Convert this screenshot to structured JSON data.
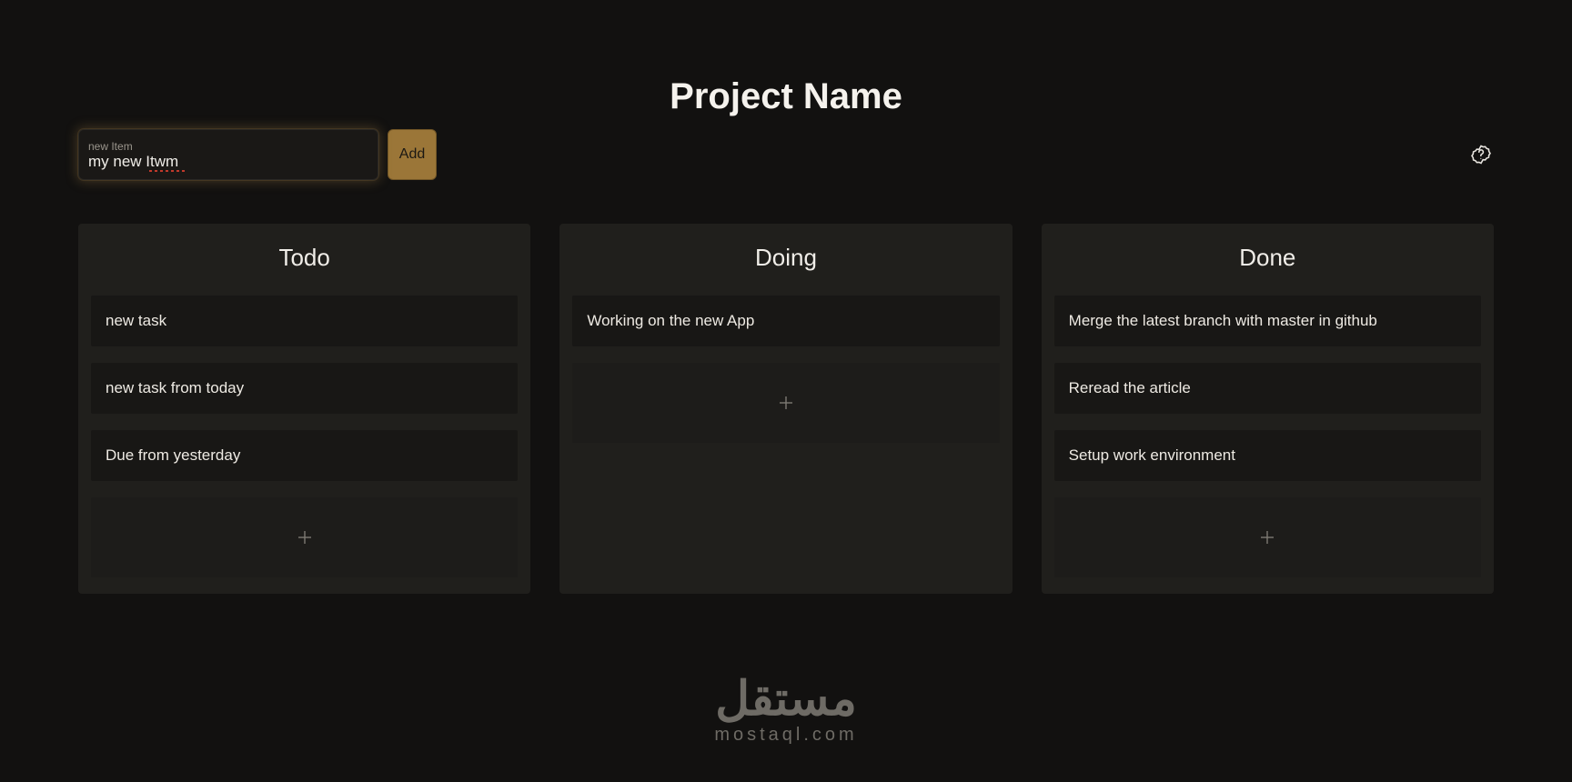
{
  "header": {
    "title": "Project Name"
  },
  "input": {
    "label": "new Item",
    "value": "my new Itwm"
  },
  "buttons": {
    "add": "Add"
  },
  "columns": [
    {
      "title": "Todo",
      "cards": [
        "new task",
        "new task from today",
        "Due from yesterday"
      ]
    },
    {
      "title": "Doing",
      "cards": [
        "Working on the new App"
      ]
    },
    {
      "title": "Done",
      "cards": [
        "Merge the latest branch with master in github",
        "Reread the article",
        "Setup work environment"
      ]
    }
  ],
  "watermark": {
    "arabic": "مستقل",
    "latin": "mostaql.com"
  }
}
